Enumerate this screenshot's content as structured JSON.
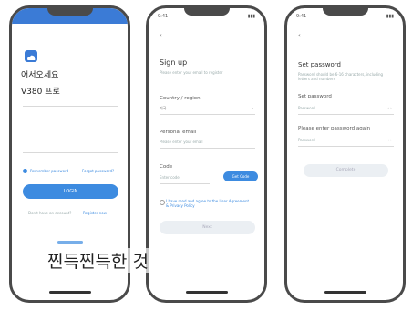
{
  "phone1": {
    "logo_icon": "cloud-camera-icon",
    "greeting": "어서오세요",
    "app_name": "V380 프로",
    "remember_label": "Remember password",
    "forgot_label": "Forgot password?",
    "login_button": "LOGIN",
    "signup_prompt": "Don't have an account?",
    "signup_link": "Register now"
  },
  "phone2": {
    "back_icon": "back-arrow-icon",
    "title": "Sign up",
    "subtitle": "Please enter your email to register",
    "country_label": "Country / region",
    "country_value": "미국",
    "email_label": "Personal email",
    "email_placeholder": "Please enter your email",
    "code_label": "Code",
    "code_placeholder": "Enter code",
    "get_code_button": "Get Code",
    "agreement_text": "I have read and agree to the User Agreement & Privacy Policy",
    "next_button": "Next"
  },
  "phone3": {
    "back_icon": "back-arrow-icon",
    "title": "Set password",
    "subtitle": "Password should be 6-16 characters, including letters and numbers",
    "password_label": "Set password",
    "password_placeholder": "Password",
    "confirm_label": "Please enter password again",
    "confirm_placeholder": "Password",
    "done_button": "Complete"
  },
  "caption": "찐득찐득한 것"
}
